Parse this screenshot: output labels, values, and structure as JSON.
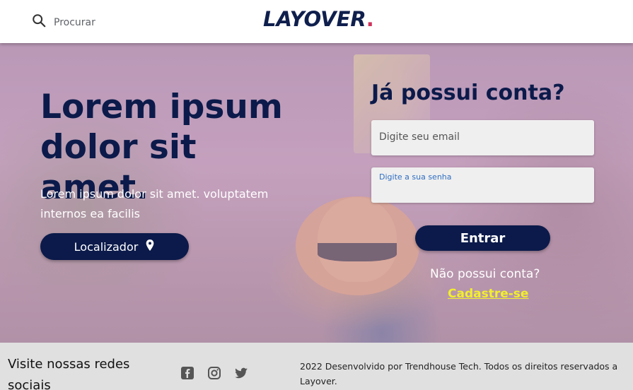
{
  "header": {
    "search_placeholder": "Procurar",
    "logo_text": "LAYOVER",
    "logo_dot": "."
  },
  "hero": {
    "title": "Lorem ipsum dolor sit amet.",
    "subtitle": "Lorem ipsum dolor sit amet. voluptatem internos ea facilis",
    "locator_button": "Localizador"
  },
  "login": {
    "title": "Já possui conta?",
    "email_placeholder": "Digite seu email",
    "password_label": "Digite a sua senha",
    "enter_button": "Entrar",
    "no_account_text": "Não possui conta?",
    "signup_link": "Cadastre-se"
  },
  "footer": {
    "social_heading": "Visite nossas redes sociais",
    "social_icons": [
      "facebook-icon",
      "instagram-icon",
      "twitter-icon"
    ],
    "copyright": "2022 Desenvolvido por Trendhouse Tech. Todos os direitos reservados a Layover."
  },
  "colors": {
    "navy": "#0b1a4a",
    "logo_dot": "#d0335c",
    "signup_link": "#f2ef2c",
    "footer_bg": "#e0e0e0"
  }
}
